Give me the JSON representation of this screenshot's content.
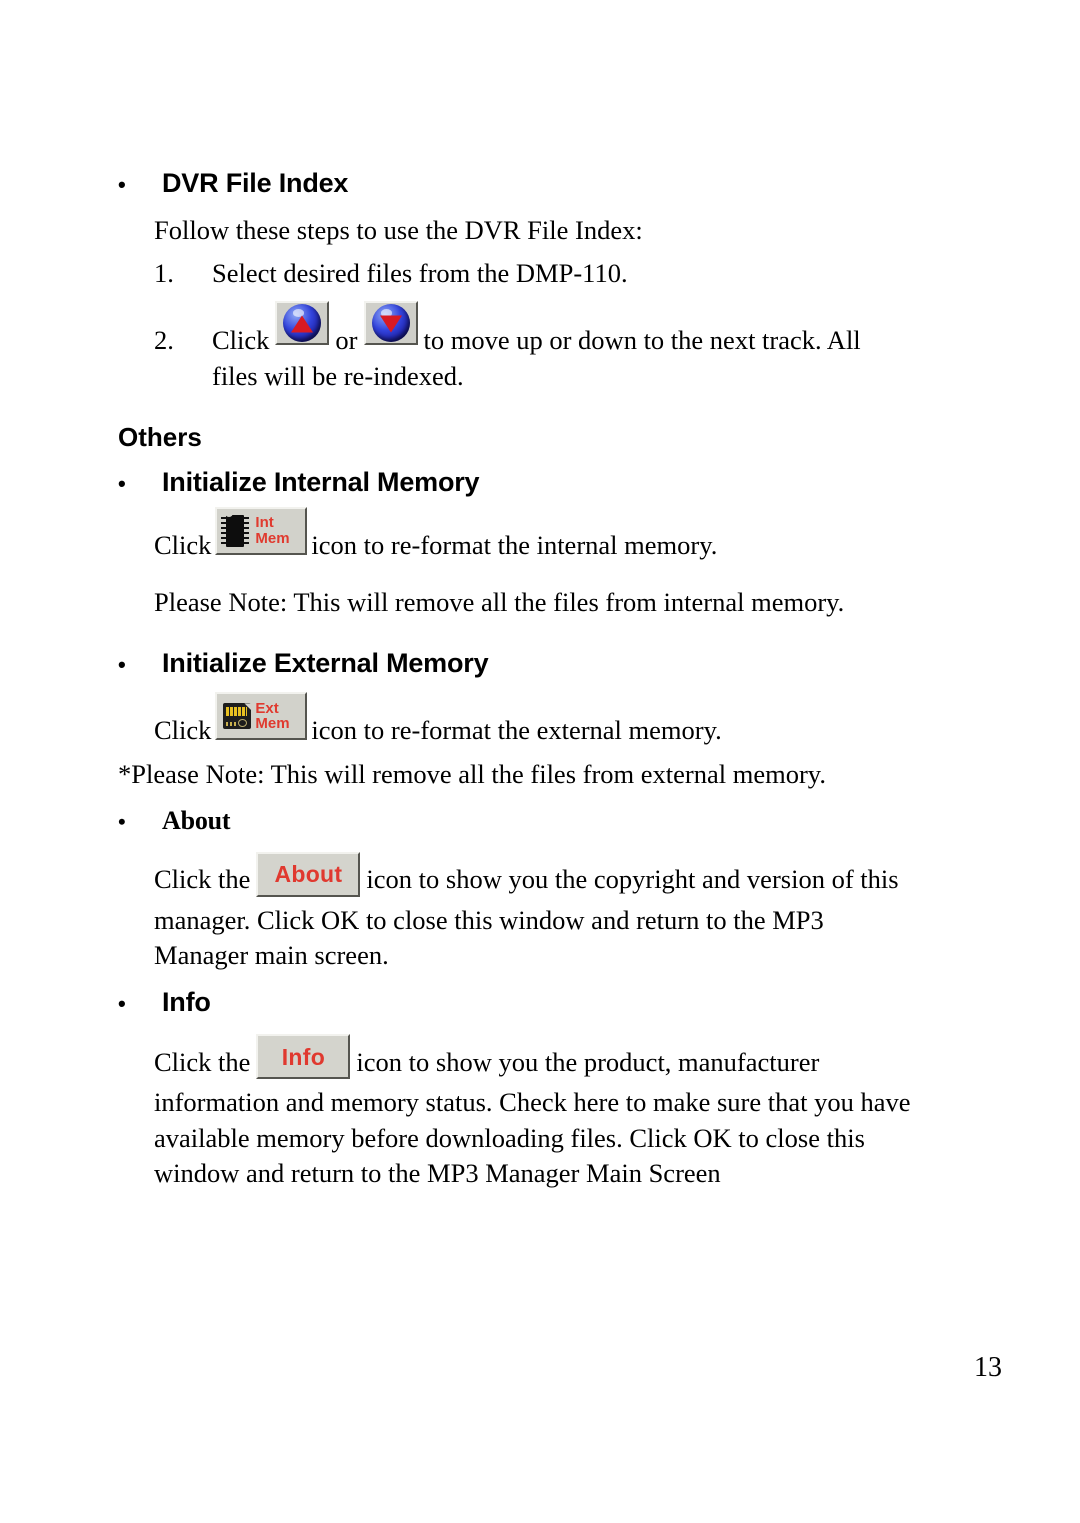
{
  "document": {
    "page_number": "13",
    "sections": [
      {
        "id": "dvr_file_index",
        "heading": "DVR File Index",
        "intro": "Follow these steps to use the DVR File Index:",
        "steps": [
          {
            "number": "1.",
            "text": "Select desired files from the DMP-110."
          }
        ],
        "step2": {
          "number": "2.",
          "before": "Click",
          "between": "or",
          "after": "to move up or down to the next track. All",
          "line2": "files will be re-indexed."
        }
      },
      {
        "id": "others",
        "heading": "Others"
      },
      {
        "id": "initialize_internal_memory",
        "heading": "Initialize Internal Memory",
        "click_before": "Click",
        "click_after": "icon to re-format the internal memory.",
        "note": "Please Note: This will remove all the files from internal memory."
      },
      {
        "id": "initialize_external_memory",
        "heading": "Initialize External Memory",
        "click_before": "Click",
        "click_after": "icon to re-format the external memory.",
        "note": "*Please Note: This will remove all the files from external memory."
      },
      {
        "id": "about",
        "heading": "About",
        "click_before": "Click the",
        "click_after": "icon to show you the copyright and version of this",
        "line2": "manager. Click OK to close this window and return to the MP3",
        "line3": "Manager main screen."
      },
      {
        "id": "info",
        "heading": "Info",
        "click_before": "Click the",
        "click_after": "icon to show you the product, manufacturer",
        "line2": "information and memory status. Check here to make sure that you have",
        "line3": "available memory before downloading files.   Click OK to close this",
        "line4": "window and return to the MP3 Manager Main Screen"
      }
    ],
    "icons": {
      "move_up": {
        "name": "move-up-button-icon",
        "glyph": "▲"
      },
      "move_down": {
        "name": "move-down-button-icon",
        "glyph": "▼"
      },
      "internal_memory": {
        "name": "int-mem-icon",
        "line1": "Int",
        "line2": "Mem"
      },
      "external_memory": {
        "name": "ext-mem-icon",
        "line1": "Ext",
        "line2": "Mem"
      },
      "about": {
        "name": "about-button-icon",
        "label": "About"
      },
      "info": {
        "name": "info-button-icon",
        "label": "Info"
      }
    },
    "bullet_glyph": "•",
    "colors": {
      "icon_text_red": "#e0392f",
      "arrow_red": "#d81a23",
      "sphere_blue": "#3344dd",
      "button_face": "#d2d2cb"
    }
  }
}
